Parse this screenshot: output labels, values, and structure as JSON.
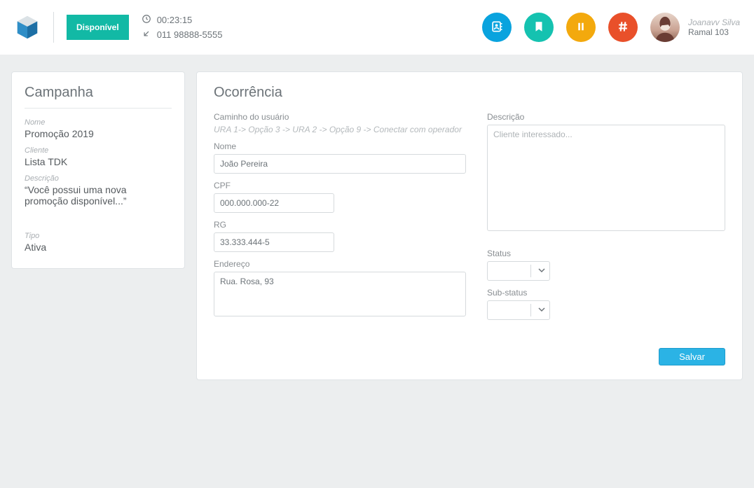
{
  "header": {
    "status_label": "Disponível",
    "timer": "00:23:15",
    "phone": "011  98888-5555",
    "user_name": "Joanavv Silva",
    "user_ext": "Ramal 103",
    "icons": {
      "contacts": "contacts-icon",
      "bookmark": "bookmark-icon",
      "pause": "pause-icon",
      "hash": "hash-icon"
    }
  },
  "campaign": {
    "title": "Campanha",
    "name_lbl": "Nome",
    "name_val": "Promoção 2019",
    "client_lbl": "Cliente",
    "client_val": "Lista TDK",
    "desc_lbl": "Descrição",
    "desc_val": "“Você possui uma nova promoção disponível...”",
    "type_lbl": "Tipo",
    "type_val": "Ativa"
  },
  "occurrence": {
    "title": "Ocorrência",
    "path_lbl": "Caminho do usuário",
    "path_val": "URA 1-> Opção 3 -> URA 2 -> Opção 9 -> Conectar com operador",
    "name_lbl": "Nome",
    "name_val": "João Pereira",
    "cpf_lbl": "CPF",
    "cpf_val": "000.000.000-22",
    "rg_lbl": "RG",
    "rg_val": "33.333.444-5",
    "addr_lbl": "Endereço",
    "addr_val": "Rua. Rosa, 93",
    "desc_lbl": "Descrição",
    "desc_placeholder": "Cliente interessado...",
    "status_lbl": "Status",
    "substatus_lbl": "Sub-status",
    "save_label": "Salvar"
  }
}
